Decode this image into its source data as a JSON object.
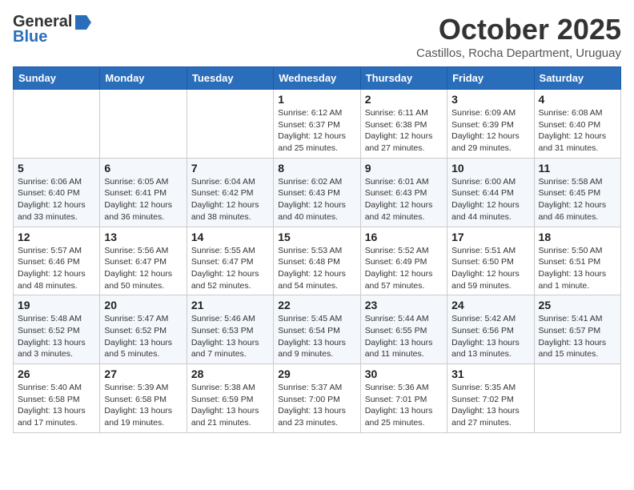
{
  "header": {
    "logo_general": "General",
    "logo_blue": "Blue",
    "month": "October 2025",
    "location": "Castillos, Rocha Department, Uruguay"
  },
  "weekdays": [
    "Sunday",
    "Monday",
    "Tuesday",
    "Wednesday",
    "Thursday",
    "Friday",
    "Saturday"
  ],
  "weeks": [
    [
      {
        "day": "",
        "info": ""
      },
      {
        "day": "",
        "info": ""
      },
      {
        "day": "",
        "info": ""
      },
      {
        "day": "1",
        "info": "Sunrise: 6:12 AM\nSunset: 6:37 PM\nDaylight: 12 hours and 25 minutes."
      },
      {
        "day": "2",
        "info": "Sunrise: 6:11 AM\nSunset: 6:38 PM\nDaylight: 12 hours and 27 minutes."
      },
      {
        "day": "3",
        "info": "Sunrise: 6:09 AM\nSunset: 6:39 PM\nDaylight: 12 hours and 29 minutes."
      },
      {
        "day": "4",
        "info": "Sunrise: 6:08 AM\nSunset: 6:40 PM\nDaylight: 12 hours and 31 minutes."
      }
    ],
    [
      {
        "day": "5",
        "info": "Sunrise: 6:06 AM\nSunset: 6:40 PM\nDaylight: 12 hours and 33 minutes."
      },
      {
        "day": "6",
        "info": "Sunrise: 6:05 AM\nSunset: 6:41 PM\nDaylight: 12 hours and 36 minutes."
      },
      {
        "day": "7",
        "info": "Sunrise: 6:04 AM\nSunset: 6:42 PM\nDaylight: 12 hours and 38 minutes."
      },
      {
        "day": "8",
        "info": "Sunrise: 6:02 AM\nSunset: 6:43 PM\nDaylight: 12 hours and 40 minutes."
      },
      {
        "day": "9",
        "info": "Sunrise: 6:01 AM\nSunset: 6:43 PM\nDaylight: 12 hours and 42 minutes."
      },
      {
        "day": "10",
        "info": "Sunrise: 6:00 AM\nSunset: 6:44 PM\nDaylight: 12 hours and 44 minutes."
      },
      {
        "day": "11",
        "info": "Sunrise: 5:58 AM\nSunset: 6:45 PM\nDaylight: 12 hours and 46 minutes."
      }
    ],
    [
      {
        "day": "12",
        "info": "Sunrise: 5:57 AM\nSunset: 6:46 PM\nDaylight: 12 hours and 48 minutes."
      },
      {
        "day": "13",
        "info": "Sunrise: 5:56 AM\nSunset: 6:47 PM\nDaylight: 12 hours and 50 minutes."
      },
      {
        "day": "14",
        "info": "Sunrise: 5:55 AM\nSunset: 6:47 PM\nDaylight: 12 hours and 52 minutes."
      },
      {
        "day": "15",
        "info": "Sunrise: 5:53 AM\nSunset: 6:48 PM\nDaylight: 12 hours and 54 minutes."
      },
      {
        "day": "16",
        "info": "Sunrise: 5:52 AM\nSunset: 6:49 PM\nDaylight: 12 hours and 57 minutes."
      },
      {
        "day": "17",
        "info": "Sunrise: 5:51 AM\nSunset: 6:50 PM\nDaylight: 12 hours and 59 minutes."
      },
      {
        "day": "18",
        "info": "Sunrise: 5:50 AM\nSunset: 6:51 PM\nDaylight: 13 hours and 1 minute."
      }
    ],
    [
      {
        "day": "19",
        "info": "Sunrise: 5:48 AM\nSunset: 6:52 PM\nDaylight: 13 hours and 3 minutes."
      },
      {
        "day": "20",
        "info": "Sunrise: 5:47 AM\nSunset: 6:52 PM\nDaylight: 13 hours and 5 minutes."
      },
      {
        "day": "21",
        "info": "Sunrise: 5:46 AM\nSunset: 6:53 PM\nDaylight: 13 hours and 7 minutes."
      },
      {
        "day": "22",
        "info": "Sunrise: 5:45 AM\nSunset: 6:54 PM\nDaylight: 13 hours and 9 minutes."
      },
      {
        "day": "23",
        "info": "Sunrise: 5:44 AM\nSunset: 6:55 PM\nDaylight: 13 hours and 11 minutes."
      },
      {
        "day": "24",
        "info": "Sunrise: 5:42 AM\nSunset: 6:56 PM\nDaylight: 13 hours and 13 minutes."
      },
      {
        "day": "25",
        "info": "Sunrise: 5:41 AM\nSunset: 6:57 PM\nDaylight: 13 hours and 15 minutes."
      }
    ],
    [
      {
        "day": "26",
        "info": "Sunrise: 5:40 AM\nSunset: 6:58 PM\nDaylight: 13 hours and 17 minutes."
      },
      {
        "day": "27",
        "info": "Sunrise: 5:39 AM\nSunset: 6:58 PM\nDaylight: 13 hours and 19 minutes."
      },
      {
        "day": "28",
        "info": "Sunrise: 5:38 AM\nSunset: 6:59 PM\nDaylight: 13 hours and 21 minutes."
      },
      {
        "day": "29",
        "info": "Sunrise: 5:37 AM\nSunset: 7:00 PM\nDaylight: 13 hours and 23 minutes."
      },
      {
        "day": "30",
        "info": "Sunrise: 5:36 AM\nSunset: 7:01 PM\nDaylight: 13 hours and 25 minutes."
      },
      {
        "day": "31",
        "info": "Sunrise: 5:35 AM\nSunset: 7:02 PM\nDaylight: 13 hours and 27 minutes."
      },
      {
        "day": "",
        "info": ""
      }
    ]
  ]
}
